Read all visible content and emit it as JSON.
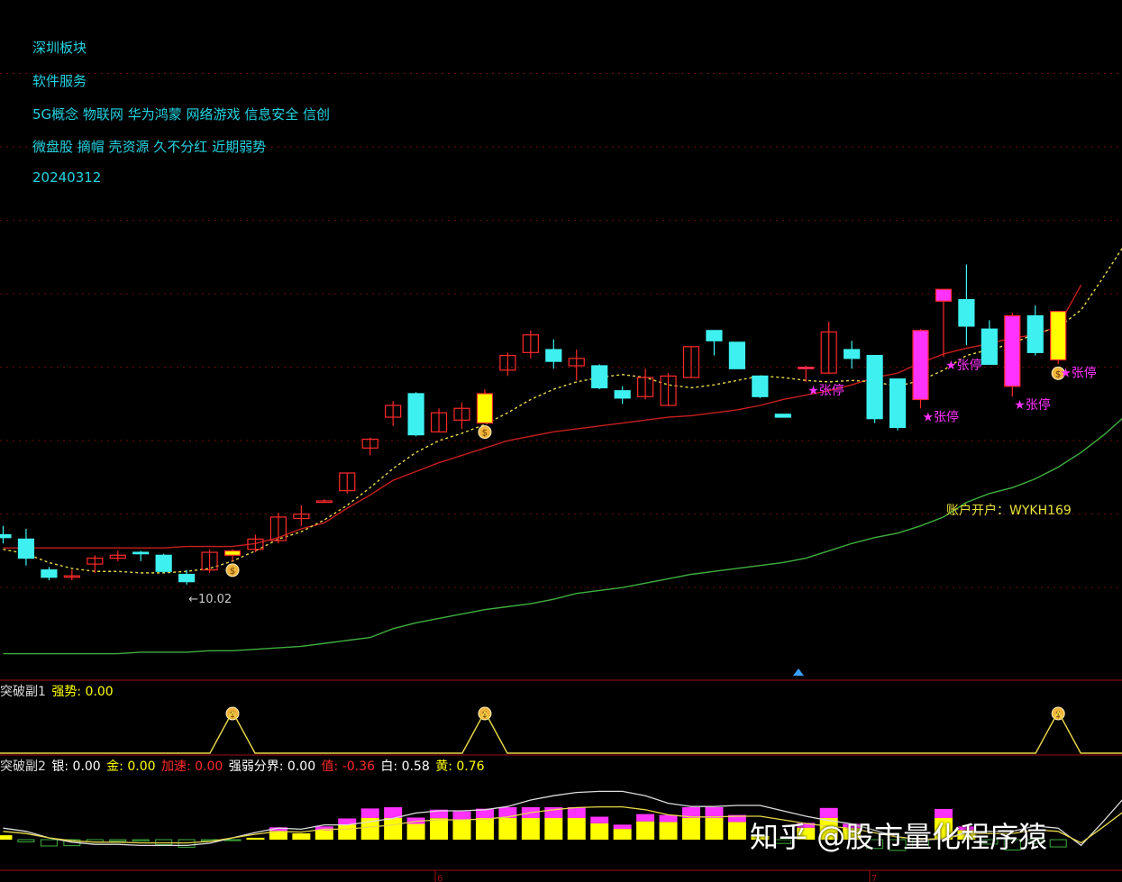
{
  "info": {
    "board": "深圳板块",
    "industry": "软件服务",
    "concepts": "5G概念 物联网 华为鸿蒙 网络游戏 信息安全 信创",
    "tags": "微盘股 摘帽 壳资源 久不分红 近期弱势",
    "date": "20240312"
  },
  "account_text": "账户开户：WYKH169",
  "watermark": "知乎 @股市量化程序猿",
  "colors": {
    "up": "#ff2a2a",
    "down": "#3ef0f0",
    "ma_short": "#e8d84a",
    "ma_mid": "#c81e1e",
    "ma_long": "#3fae3f",
    "limit": "#ff33ff",
    "gold": "#ffff00",
    "info": "#22d3e0"
  },
  "sub1": {
    "title": "突破副1",
    "items": [
      {
        "label": "强势",
        "value": "0.00",
        "color": "#ffff00"
      }
    ]
  },
  "sub2": {
    "title": "突破副2",
    "items": [
      {
        "label": "银",
        "value": "0.00",
        "color": "#ffffff"
      },
      {
        "label": "金",
        "value": "0.00",
        "color": "#ffff00"
      },
      {
        "label": "加速",
        "value": "0.00",
        "color": "#ff2a2a"
      },
      {
        "label": "强弱分界",
        "value": "0.00",
        "color": "#ffffff"
      },
      {
        "label": "值",
        "value": "-0.36",
        "color": "#ff2a2a"
      },
      {
        "label": "白",
        "value": "0.58",
        "color": "#ffffff"
      },
      {
        "label": "黄",
        "value": "0.76",
        "color": "#ffff00"
      }
    ]
  },
  "chart_data": {
    "type": "candlestick",
    "ylim": [
      9.4,
      14.0
    ],
    "gridlines": [
      13.5,
      13.0,
      12.5,
      12.0,
      11.5,
      11.0,
      10.5,
      10.0
    ],
    "low_annotation": {
      "text": "←10.02",
      "candle": 8
    },
    "limit_label": "张停",
    "x_markers": [
      "6",
      "7"
    ],
    "candles": [
      {
        "o": 10.36,
        "h": 10.42,
        "l": 10.3,
        "c": 10.34
      },
      {
        "o": 10.33,
        "h": 10.4,
        "l": 10.15,
        "c": 10.2
      },
      {
        "o": 10.12,
        "h": 10.14,
        "l": 10.05,
        "c": 10.07
      },
      {
        "o": 10.07,
        "h": 10.12,
        "l": 10.05,
        "c": 10.08
      },
      {
        "o": 10.16,
        "h": 10.22,
        "l": 10.1,
        "c": 10.2
      },
      {
        "o": 10.2,
        "h": 10.25,
        "l": 10.18,
        "c": 10.22
      },
      {
        "o": 10.24,
        "h": 10.25,
        "l": 10.18,
        "c": 10.23
      },
      {
        "o": 10.22,
        "h": 10.23,
        "l": 10.1,
        "c": 10.11
      },
      {
        "o": 10.09,
        "h": 10.12,
        "l": 10.02,
        "c": 10.04
      },
      {
        "o": 10.12,
        "h": 10.26,
        "l": 10.1,
        "c": 10.24
      },
      {
        "o": 10.22,
        "h": 10.26,
        "l": 10.18,
        "c": 10.25,
        "gold": true,
        "signal": true
      },
      {
        "o": 10.26,
        "h": 10.36,
        "l": 10.24,
        "c": 10.33
      },
      {
        "o": 10.32,
        "h": 10.51,
        "l": 10.3,
        "c": 10.48
      },
      {
        "o": 10.47,
        "h": 10.56,
        "l": 10.42,
        "c": 10.5
      },
      {
        "o": 10.58,
        "h": 10.6,
        "l": 10.58,
        "c": 10.59
      },
      {
        "o": 10.66,
        "h": 10.78,
        "l": 10.64,
        "c": 10.78
      },
      {
        "o": 10.95,
        "h": 11.02,
        "l": 10.9,
        "c": 11.01
      },
      {
        "o": 11.16,
        "h": 11.27,
        "l": 11.1,
        "c": 11.24
      },
      {
        "o": 11.32,
        "h": 11.33,
        "l": 11.03,
        "c": 11.04
      },
      {
        "o": 11.06,
        "h": 11.22,
        "l": 11.06,
        "c": 11.19
      },
      {
        "o": 11.14,
        "h": 11.26,
        "l": 11.08,
        "c": 11.22
      },
      {
        "o": 11.12,
        "h": 11.35,
        "l": 11.12,
        "c": 11.32,
        "gold": true,
        "signal": true
      },
      {
        "o": 11.48,
        "h": 11.6,
        "l": 11.44,
        "c": 11.58
      },
      {
        "o": 11.6,
        "h": 11.75,
        "l": 11.56,
        "c": 11.72
      },
      {
        "o": 11.62,
        "h": 11.69,
        "l": 11.49,
        "c": 11.54
      },
      {
        "o": 11.51,
        "h": 11.62,
        "l": 11.41,
        "c": 11.56
      },
      {
        "o": 11.51,
        "h": 11.52,
        "l": 11.35,
        "c": 11.36
      },
      {
        "o": 11.34,
        "h": 11.37,
        "l": 11.25,
        "c": 11.29
      },
      {
        "o": 11.3,
        "h": 11.49,
        "l": 11.28,
        "c": 11.43
      },
      {
        "o": 11.24,
        "h": 11.46,
        "l": 11.24,
        "c": 11.44
      },
      {
        "o": 11.43,
        "h": 11.64,
        "l": 11.43,
        "c": 11.64
      },
      {
        "o": 11.75,
        "h": 11.75,
        "l": 11.58,
        "c": 11.68
      },
      {
        "o": 11.67,
        "h": 11.67,
        "l": 11.5,
        "c": 11.49
      },
      {
        "o": 11.44,
        "h": 11.44,
        "l": 11.29,
        "c": 11.3
      },
      {
        "o": 11.18,
        "h": 11.18,
        "l": 11.16,
        "c": 11.16
      },
      {
        "o": 11.49,
        "h": 11.51,
        "l": 11.4,
        "c": 11.5,
        "limit": true
      },
      {
        "o": 11.46,
        "h": 11.81,
        "l": 11.46,
        "c": 11.74
      },
      {
        "o": 11.62,
        "h": 11.68,
        "l": 11.49,
        "c": 11.56
      },
      {
        "o": 11.58,
        "h": 11.58,
        "l": 11.12,
        "c": 11.15
      },
      {
        "o": 11.42,
        "h": 11.42,
        "l": 11.07,
        "c": 11.09
      },
      {
        "o": 11.75,
        "h": 11.76,
        "l": 11.22,
        "c": 11.28,
        "limit": true
      },
      {
        "o": 12.03,
        "h": 12.03,
        "l": 11.57,
        "c": 11.95,
        "limit": true
      },
      {
        "o": 11.96,
        "h": 12.2,
        "l": 11.65,
        "c": 11.78
      },
      {
        "o": 11.76,
        "h": 11.82,
        "l": 11.52,
        "c": 11.52
      },
      {
        "o": 11.85,
        "h": 11.87,
        "l": 11.3,
        "c": 11.37,
        "limit": true
      },
      {
        "o": 11.85,
        "h": 11.92,
        "l": 11.58,
        "c": 11.6
      },
      {
        "o": 11.88,
        "h": 11.88,
        "l": 11.52,
        "c": 11.55,
        "gold": true,
        "limit": true,
        "signal": true
      }
    ],
    "ma_short": [
      10.26,
      10.23,
      10.17,
      10.13,
      10.11,
      10.11,
      10.1,
      10.1,
      10.11,
      10.13,
      10.18,
      10.25,
      10.33,
      10.38,
      10.46,
      10.56,
      10.68,
      10.81,
      10.92,
      11.0,
      11.05,
      11.11,
      11.19,
      11.28,
      11.35,
      11.4,
      11.43,
      11.45,
      11.43,
      11.38,
      11.36,
      11.38,
      11.41,
      11.44,
      11.43,
      11.41,
      11.4,
      11.41,
      11.4,
      11.37,
      11.41,
      11.48,
      11.58,
      11.62,
      11.66,
      11.73,
      11.77,
      11.89,
      12.12,
      12.36
    ],
    "ma_mid": [
      10.27,
      10.27,
      10.27,
      10.27,
      10.27,
      10.27,
      10.27,
      10.27,
      10.28,
      10.28,
      10.28,
      10.3,
      10.34,
      10.4,
      10.44,
      10.54,
      10.63,
      10.73,
      10.79,
      10.85,
      10.9,
      10.95,
      11.0,
      11.03,
      11.06,
      11.08,
      11.1,
      11.12,
      11.14,
      11.16,
      11.17,
      11.19,
      11.21,
      11.24,
      11.28,
      11.31,
      11.34,
      11.38,
      11.43,
      11.46,
      11.53,
      11.59,
      11.63,
      11.66,
      11.7,
      11.72,
      11.78,
      12.06
    ],
    "ma_long": [
      9.55,
      9.55,
      9.55,
      9.55,
      9.55,
      9.55,
      9.56,
      9.56,
      9.56,
      9.57,
      9.57,
      9.58,
      9.59,
      9.6,
      9.62,
      9.64,
      9.66,
      9.72,
      9.76,
      9.79,
      9.82,
      9.85,
      9.87,
      9.89,
      9.92,
      9.96,
      9.98,
      10.0,
      10.03,
      10.06,
      10.09,
      10.11,
      10.13,
      10.15,
      10.17,
      10.2,
      10.25,
      10.3,
      10.34,
      10.37,
      10.42,
      10.48,
      10.58,
      10.64,
      10.68,
      10.74,
      10.82,
      10.92,
      11.04,
      11.18
    ]
  }
}
